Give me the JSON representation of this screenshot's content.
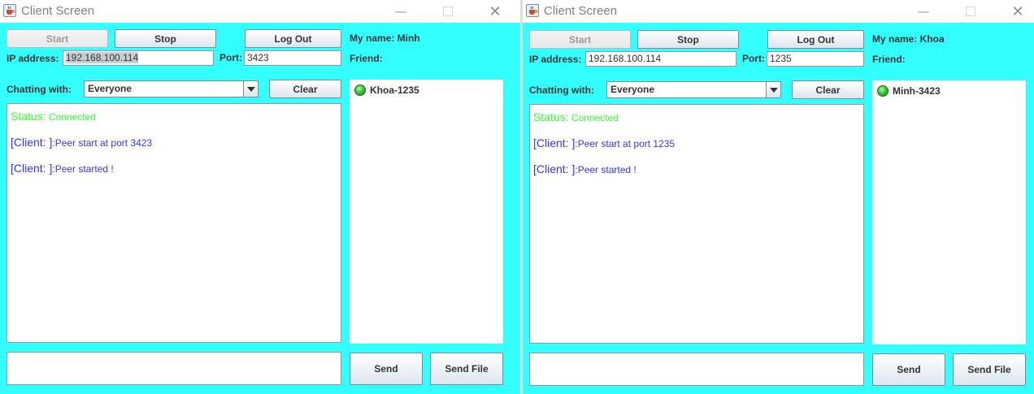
{
  "windows": [
    {
      "title": "Client Screen",
      "start_label": "Start",
      "stop_label": "Stop",
      "logout_label": "Log Out",
      "my_name_label": "My name: Minh",
      "ip_label": "IP address:",
      "ip_value": "192.168.100.114",
      "port_label": "Port:",
      "port_value": "3423",
      "friend_label": "Friend:",
      "chatting_with_label": "Chatting with:",
      "chatting_with_value": "Everyone",
      "clear_label": "Clear",
      "messages": [
        {
          "key": "Status:",
          "text": " Connected",
          "kind": "status"
        },
        {
          "key": "[Client: ]",
          "text": ":Peer start at port 3423",
          "kind": "client"
        },
        {
          "key": "[Client: ]",
          "text": ":Peer started !",
          "kind": "client"
        }
      ],
      "friends": [
        {
          "name": "Khoa-1235",
          "online": true
        }
      ],
      "send_label": "Send",
      "send_file_label": "Send File",
      "message_input_value": ""
    },
    {
      "title": "Client Screen",
      "start_label": "Start",
      "stop_label": "Stop",
      "logout_label": "Log Out",
      "my_name_label": "My name: Khoa",
      "ip_label": "IP address:",
      "ip_value": "192.168.100.114",
      "port_label": "Port:",
      "port_value": "1235",
      "friend_label": "Friend:",
      "chatting_with_label": "Chatting with:",
      "chatting_with_value": "Everyone",
      "clear_label": "Clear",
      "messages": [
        {
          "key": "Status:",
          "text": " Connected",
          "kind": "status"
        },
        {
          "key": "[Client: ]",
          "text": ":Peer start at port 1235",
          "kind": "client"
        },
        {
          "key": "[Client: ]",
          "text": ":Peer started !",
          "kind": "client"
        }
      ],
      "friends": [
        {
          "name": "Minh-3423",
          "online": true
        }
      ],
      "send_label": "Send",
      "send_file_label": "Send File",
      "message_input_value": ""
    }
  ],
  "titlebar_icons": {
    "minimize": "minimize-icon",
    "maximize": "maximize-icon",
    "close": "close-icon",
    "app": "java-cup-icon"
  },
  "colors": {
    "background": "#33FFFF",
    "status_text": "#33FF33",
    "client_text": "#3333FF",
    "online_indicator": "#3FC23F"
  }
}
